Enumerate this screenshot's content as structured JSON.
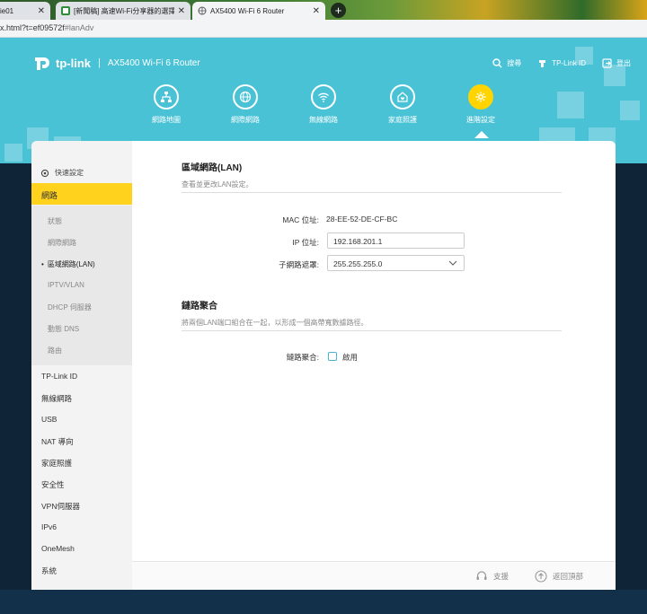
{
  "browser": {
    "tabs": [
      {
        "title": "ie01",
        "active": false
      },
      {
        "title": "[新聞稿] 高速Wi-Fi分享器的選擇",
        "active": false
      },
      {
        "title": "AX5400 Wi-Fi 6 Router",
        "active": true
      }
    ],
    "new_tab": "+",
    "url_prefix": "x.html?t=ef09572f",
    "url_hash": "#lanAdv"
  },
  "header": {
    "brand": "tp-link",
    "separator": "|",
    "model": "AX5400 Wi-Fi 6 Router",
    "top_links": {
      "search": "搜尋",
      "tplink_id": "TP-Link ID",
      "logout": "登出"
    },
    "nav": [
      {
        "label": "網路地圖",
        "icon": "network-map-icon"
      },
      {
        "label": "網際網路",
        "icon": "globe-icon"
      },
      {
        "label": "無線網路",
        "icon": "wifi-icon"
      },
      {
        "label": "家庭照護",
        "icon": "home-care-icon"
      },
      {
        "label": "進階設定",
        "icon": "gear-icon",
        "active": true
      }
    ]
  },
  "sidebar": {
    "quick_setup": "快速設定",
    "active_section": "網路",
    "sub_items": [
      "狀態",
      "網際網路",
      "區域網路(LAN)",
      "IPTV/VLAN",
      "DHCP 伺服器",
      "動態 DNS",
      "路由"
    ],
    "current_sub": "區域網路(LAN)",
    "items": [
      "TP-Link ID",
      "無線網路",
      "USB",
      "NAT 導向",
      "家庭照護",
      "安全性",
      "VPN伺服器",
      "IPv6",
      "OneMesh",
      "系統"
    ]
  },
  "lan": {
    "title": "區域網路(LAN)",
    "subtitle": "查看並更改LAN設定。",
    "mac_label": "MAC 位址:",
    "mac_value": "28-EE-52-DE-CF-BC",
    "ip_label": "IP 位址:",
    "ip_value": "192.168.201.1",
    "mask_label": "子網路遮罩:",
    "mask_value": "255.255.255.0"
  },
  "aggregation": {
    "title": "鏈路聚合",
    "subtitle": "將兩個LAN端口組合在一起，以形成一個高帶寬數據路徑。",
    "label": "鏈路聚合:",
    "checkbox_label": "啟用",
    "checked": false
  },
  "footer": {
    "support": "支援",
    "back_to_top": "返回頂部"
  },
  "colors": {
    "header_bg": "#4ac2d6",
    "accent": "#ffd21e"
  }
}
